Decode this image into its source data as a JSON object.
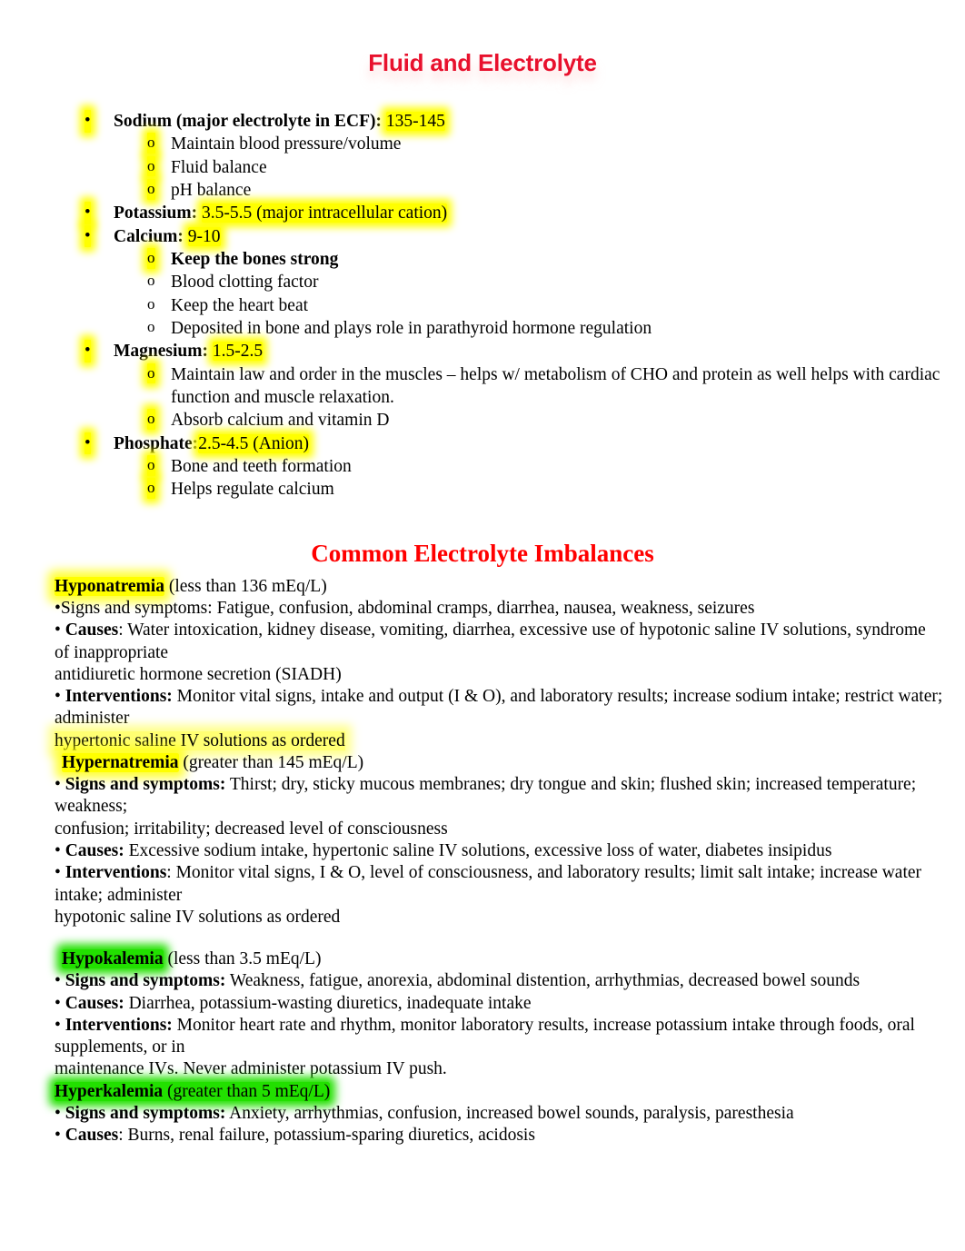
{
  "document": {
    "title": "Fluid and Electrolyte",
    "title_color": "#E8112D",
    "section_title": "Common Electrolyte Imbalances",
    "section_title_color": "#FF0000",
    "highlight_yellow": "#FFFF00",
    "highlight_green": "#22E000"
  },
  "electrolytes": [
    {
      "bullet": "•",
      "label": "Sodium (major electrolyte in ECF):",
      "value": "135-145",
      "sub_bullet": "o",
      "subs": [
        {
          "text": "Maintain blood pressure/volume",
          "bold": false
        },
        {
          "text": "Fluid balance",
          "bold": false
        },
        {
          "text": "pH balance",
          "bold": false
        }
      ]
    },
    {
      "bullet": "•",
      "label": "Potassium:",
      "value": "3.5-5.5 (major intracellular cation)",
      "sub_bullet": "o",
      "subs": []
    },
    {
      "bullet": "•",
      "label": "Calcium:",
      "value": "9-10",
      "sub_bullet": "o",
      "subs": [
        {
          "text": "Keep the bones strong",
          "bold": true
        },
        {
          "text": "Blood clotting factor",
          "bold": false
        },
        {
          "text": "Keep the heart beat",
          "bold": false
        },
        {
          "text": "Deposited in bone and plays role in parathyroid hormone regulation",
          "bold": false
        }
      ]
    },
    {
      "bullet": "•",
      "label": "Magnesium:",
      "value": "1.5-2.5",
      "sub_bullet": "o",
      "subs": [
        {
          "text": "Maintain law and order in the muscles – helps w/ metabolism of CHO and protein as well helps with cardiac function and muscle relaxation.",
          "bold": false
        },
        {
          "text": "Absorb calcium and vitamin D",
          "bold": false
        }
      ]
    },
    {
      "bullet": "•",
      "label": "Phosphate:",
      "value": "2.5-4.5 (Anion)",
      "sub_bullet": "o",
      "subs": [
        {
          "text": "Bone and teeth formation",
          "bold": false
        },
        {
          "text": "Helps regulate calcium",
          "bold": false
        }
      ]
    }
  ],
  "imbalances": {
    "hyponatremia": {
      "name": "Hyponatremia",
      "range": " (less than 136 mEq/L)",
      "highlight": "yellow",
      "indent": false,
      "lines": [
        {
          "bullet": "•",
          "bullet_space": false,
          "label": "Signs and symptoms:",
          "label_bold": false,
          "body": " Fatigue, confusion, abdominal cramps, diarrhea, nausea, weakness, seizures"
        },
        {
          "bullet": "•",
          "bullet_space": true,
          "label": "Causes",
          "label_bold": true,
          "label_tail": ":",
          "body": " Water intoxication, kidney disease, vomiting, diarrhea, excessive use of hypotonic saline IV solutions, syndrome of inappropriate"
        },
        {
          "bullet": "",
          "bullet_space": false,
          "label": "",
          "label_bold": false,
          "body": "antidiuretic hormone secretion (SIADH)"
        },
        {
          "bullet": "•",
          "bullet_space": true,
          "label": "Interventions:",
          "label_bold": true,
          "body": " Monitor vital signs, intake and output (I & O), and laboratory results; increase sodium intake; restrict water; administer"
        },
        {
          "bullet": "",
          "bullet_space": false,
          "label": "",
          "label_bold": false,
          "body": "hypertonic saline IV solutions as ordered",
          "trailing_highlight": true
        }
      ]
    },
    "hypernatremia": {
      "name": "Hypernatremia",
      "range": " (greater than 145 mEq/L)",
      "highlight": "yellow",
      "indent": true,
      "lines": [
        {
          "bullet": "•",
          "bullet_space": true,
          "label": "Signs and symptoms:",
          "label_bold": true,
          "body": " Thirst; dry, sticky mucous membranes; dry tongue and skin; flushed skin; increased temperature; weakness;"
        },
        {
          "bullet": "",
          "bullet_space": false,
          "label": "",
          "label_bold": false,
          "body": "confusion; irritability; decreased level of consciousness"
        },
        {
          "bullet": "•",
          "bullet_space": true,
          "label": "Causes:",
          "label_bold": true,
          "body": " Excessive sodium intake, hypertonic saline IV solutions, excessive loss of water, diabetes insipidus"
        },
        {
          "bullet": "•",
          "bullet_space": true,
          "label": "Interventions",
          "label_bold": true,
          "label_tail": ":",
          "body": " Monitor vital signs, I & O, level of consciousness, and laboratory results; limit salt intake; increase water intake; administer"
        },
        {
          "bullet": "",
          "bullet_space": false,
          "label": "",
          "label_bold": false,
          "body": "hypotonic saline IV solutions as ordered"
        }
      ]
    },
    "hypokalemia": {
      "name": "Hypokalemia",
      "range": " (less than 3.5 mEq/L)",
      "highlight": "green",
      "indent": true,
      "lines": [
        {
          "bullet": "•",
          "bullet_space": true,
          "label": "Signs and symptoms:",
          "label_bold": true,
          "body": " Weakness, fatigue, anorexia, abdominal distention, arrhythmias, decreased bowel sounds"
        },
        {
          "bullet": "•",
          "bullet_space": true,
          "label": "Causes:",
          "label_bold": true,
          "body": " Diarrhea, potassium-wasting diuretics, inadequate intake"
        },
        {
          "bullet": "•",
          "bullet_space": true,
          "label": "Interventions:",
          "label_bold": true,
          "body": " Monitor heart rate and rhythm, monitor laboratory results, increase potassium intake through foods, oral supplements, or in"
        },
        {
          "bullet": "",
          "bullet_space": false,
          "label": "",
          "label_bold": false,
          "body": "maintenance IVs. Never administer potassium IV push."
        }
      ]
    },
    "hyperkalemia": {
      "name": "Hyperkalemia",
      "range": " (greater than 5 mEq/L)",
      "highlight": "green",
      "highlight_full_line": true,
      "indent": false,
      "lines": [
        {
          "bullet": "•",
          "bullet_space": true,
          "label": "Signs and symptoms:",
          "label_bold": true,
          "body": " Anxiety, arrhythmias, confusion, increased bowel sounds, paralysis, paresthesia"
        },
        {
          "bullet": "•",
          "bullet_space": true,
          "label": "Causes",
          "label_bold": true,
          "label_tail": ":",
          "body": " Burns, renal failure, potassium-sparing diuretics, acidosis"
        }
      ]
    }
  }
}
